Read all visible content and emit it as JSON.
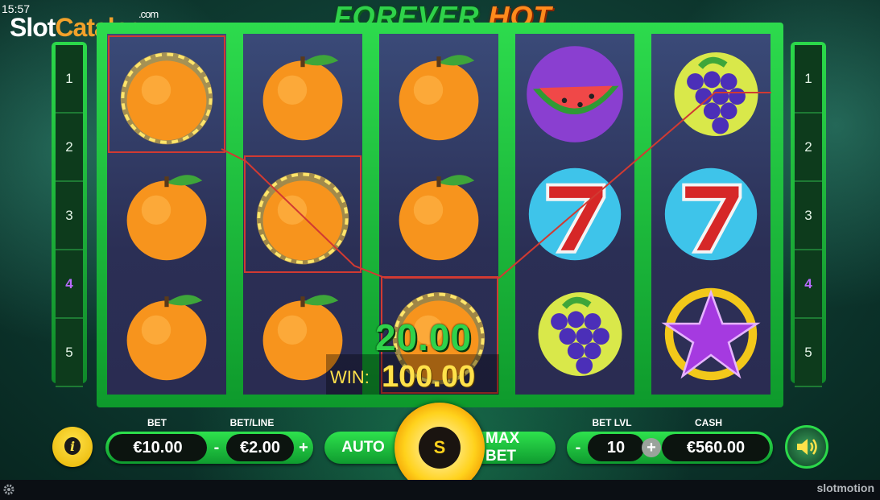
{
  "status": {
    "clock": "15:57"
  },
  "watermark": {
    "part1": "Slot",
    "part2": "Catalog",
    "suffix": ".com"
  },
  "game": {
    "title_part1": "FOREVER",
    "title_part2": "HOT",
    "provider": "slotmotion"
  },
  "paylines": {
    "left": [
      "1",
      "2",
      "3",
      "4",
      "5"
    ],
    "right": [
      "1",
      "2",
      "3",
      "4",
      "5"
    ],
    "active": "4"
  },
  "reels": [
    [
      "orange-burning",
      "orange",
      "orange"
    ],
    [
      "orange",
      "orange-burning",
      "orange"
    ],
    [
      "orange",
      "orange",
      "orange-burning"
    ],
    [
      "watermelon",
      "seven",
      "grapes"
    ],
    [
      "grapes",
      "seven",
      "star"
    ]
  ],
  "win": {
    "line_win": "20.00",
    "label": "WIN:",
    "amount": "100.00"
  },
  "controls": {
    "bet_label": "BET",
    "bet_value": "€10.00",
    "betline_label": "BET/LINE",
    "betline_value": "€2.00",
    "minus": "-",
    "plus": "+",
    "auto_label": "AUTO",
    "spin_label": "S",
    "maxbet_label": "MAX BET",
    "betlvl_label": "BET LVL",
    "betlvl_value": "10",
    "cash_label": "CASH",
    "cash_value": "€560.00",
    "info_label": "i"
  },
  "colors": {
    "win_line": "#d13a32",
    "accent_green": "#2bd94a",
    "gold": "#ffd21c"
  }
}
